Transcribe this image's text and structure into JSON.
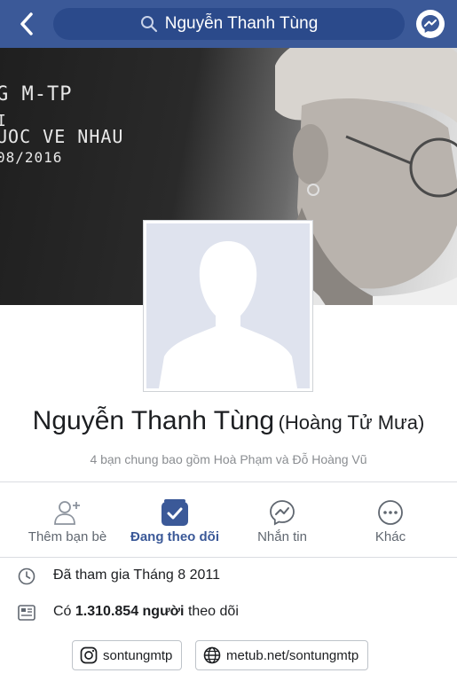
{
  "header": {
    "search_query": "Nguyễn Thanh Tùng",
    "bar_color": "#3b5998"
  },
  "cover": {
    "line1": "G M-TP",
    "line2": "I",
    "line3": "UOC VE NHAU",
    "line4": "08/2016"
  },
  "profile": {
    "name": "Nguyễn Thanh Tùng",
    "alternate_name": "(Hoàng Tử Mưa)",
    "mutual_friends": "4 bạn chung bao gồm Hoà Phạm và Đỗ Hoàng Vũ"
  },
  "actions": [
    {
      "label": "Thêm bạn bè",
      "icon": "add-friend-icon"
    },
    {
      "label": "Đang theo dõi",
      "icon": "following-check-icon",
      "active": true
    },
    {
      "label": "Nhắn tin",
      "icon": "messenger-icon"
    },
    {
      "label": "Khác",
      "icon": "more-icon"
    }
  ],
  "info": {
    "joined": "Đã tham gia Tháng 8 2011",
    "followers_prefix": "Có",
    "followers_count": "1.310.854 người",
    "followers_suffix": "theo dõi"
  },
  "links": {
    "instagram": "sontungmtp",
    "website": "metub.net/sontungmtp"
  },
  "colors": {
    "accent": "#3b5998",
    "muted_text": "#8a8d91"
  }
}
